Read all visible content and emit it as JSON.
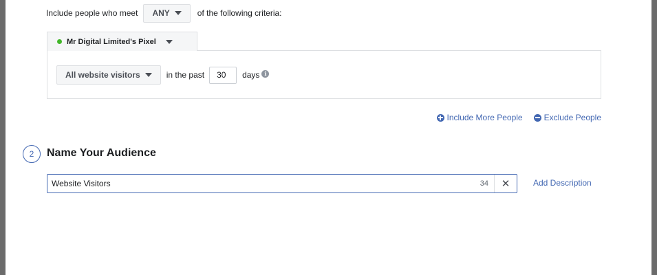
{
  "criteria": {
    "prefix": "Include people who meet",
    "match_value": "ANY",
    "suffix": "of the following criteria:"
  },
  "pixel_tab": {
    "label": "Mr Digital Limited's Pixel",
    "status_color": "#42b72a"
  },
  "rule": {
    "visitors_option": "All website visitors",
    "in_the_past_label": "in the past",
    "days_value": "30",
    "days_label": "days"
  },
  "actions": {
    "include_more": "Include More People",
    "exclude": "Exclude People"
  },
  "name_section": {
    "step_number": "2",
    "title": "Name Your Audience",
    "audience_name": "Website Visitors",
    "char_count": "34",
    "clear_glyph": "✕",
    "add_description": "Add Description"
  },
  "colors": {
    "accent": "#4267b2",
    "background_frame": "#6b6b6b"
  }
}
